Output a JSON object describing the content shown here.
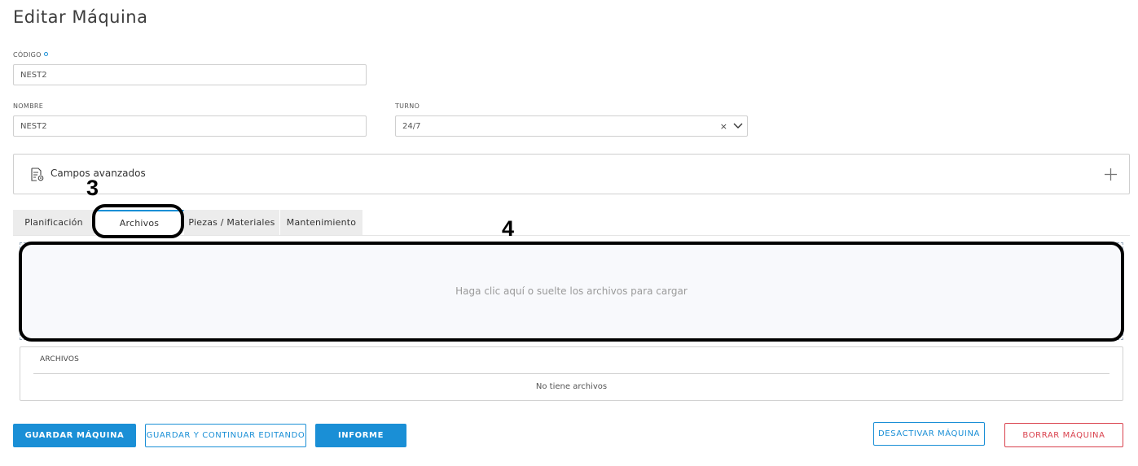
{
  "page": {
    "title": "Editar Máquina"
  },
  "form": {
    "codigo": {
      "label": "CÓDIGO",
      "value": "NEST2"
    },
    "nombre": {
      "label": "NOMBRE",
      "value": "NEST2"
    },
    "turno": {
      "label": "TURNO",
      "value": "24/7",
      "clear": "×"
    }
  },
  "advanced": {
    "label": "Campos avanzados"
  },
  "tabs": [
    {
      "label": "Planificación",
      "active": false
    },
    {
      "label": "Archivos",
      "active": true
    },
    {
      "label": "Piezas / Materiales",
      "active": false
    },
    {
      "label": "Mantenimiento",
      "active": false
    }
  ],
  "dropzone": {
    "text": "Haga clic aquí o suelte los archivos para cargar"
  },
  "files": {
    "header": "ARCHIVOS",
    "empty": "No tiene archivos"
  },
  "buttons": {
    "save": "GUARDAR MÁQUINA",
    "save_continue": "GUARDAR Y CONTINUAR EDITANDO",
    "report": "INFORME",
    "deactivate": "DESACTIVAR MÁQUINA",
    "delete": "BORRAR MÁQUINA"
  },
  "annotations": {
    "tab_marker": "3",
    "dropzone_marker": "4"
  },
  "colors": {
    "accent": "#1a8fd6",
    "danger": "#d9414d",
    "tab_bg": "#ececec",
    "dropzone_bg": "#f8f9fc"
  }
}
